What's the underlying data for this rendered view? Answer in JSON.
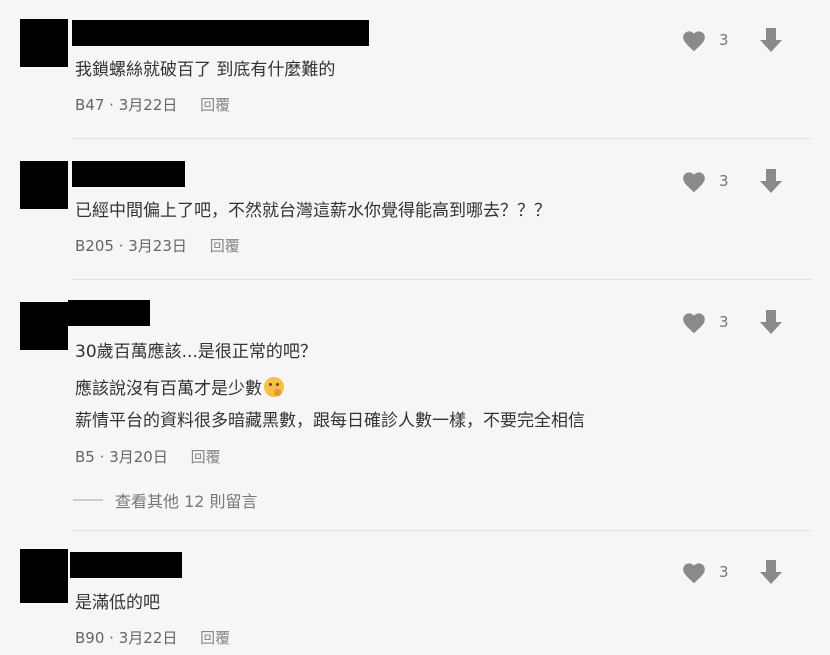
{
  "comments": [
    {
      "lines": [
        "我鎖螺絲就破百了 到底有什麼難的"
      ],
      "floor": "B47",
      "date": "3月22日",
      "reply": "回覆",
      "likes": "3"
    },
    {
      "lines": [
        "已經中間偏上了吧，不然就台灣這薪水你覺得能高到哪去？？？"
      ],
      "floor": "B205",
      "date": "3月23日",
      "reply": "回覆",
      "likes": "3"
    },
    {
      "lines": [
        "30歲百萬應該...是很正常的吧？",
        "應該說沒有百萬才是少數",
        "薪情平台的資料很多暗藏黑數，跟每日確診人數一樣，不要完全相信"
      ],
      "floor": "B5",
      "date": "3月20日",
      "reply": "回覆",
      "likes": "3",
      "more_replies": "查看其他 12 則留言"
    },
    {
      "lines": [
        "是滿低的吧"
      ],
      "floor": "B90",
      "date": "3月22日",
      "reply": "回覆",
      "likes": "3"
    }
  ],
  "separator": "·",
  "icons": {
    "like": "heart-icon",
    "dislike": "down-arrow-icon",
    "emoji": "thinking-face-emoji"
  },
  "colors": {
    "background": "#f6f6f6",
    "icon": "#8a8a8a",
    "text": "#333333",
    "meta": "#666666"
  }
}
